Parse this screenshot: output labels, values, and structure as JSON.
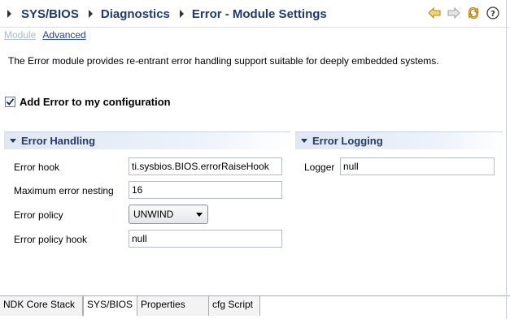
{
  "breadcrumb": {
    "items": [
      "SYS/BIOS",
      "Diagnostics",
      "Error - Module Settings"
    ]
  },
  "header_tools": [
    "back-icon",
    "forward-icon",
    "refresh-icon",
    "help-icon"
  ],
  "subtabs": {
    "module": "Module",
    "advanced": "Advanced"
  },
  "description": "The Error module provides re-entrant error handling support suitable for deeply embedded systems.",
  "add_config": {
    "label": "Add Error to my configuration",
    "checked": true
  },
  "error_handling": {
    "title": "Error Handling",
    "hook_label": "Error hook",
    "hook_value": "ti.sysbios.BIOS.errorRaiseHook",
    "nesting_label": "Maximum error nesting",
    "nesting_value": "16",
    "policy_label": "Error policy",
    "policy_value": "UNWIND",
    "policy_hook_label": "Error policy hook",
    "policy_hook_value": "null"
  },
  "error_logging": {
    "title": "Error Logging",
    "logger_label": "Logger",
    "logger_value": "null"
  },
  "bottom_tabs": [
    "NDK Core Stack",
    "SYS/BIOS",
    "Properties",
    "cfg Script"
  ],
  "active_bottom_tab": "SYS/BIOS",
  "colors": {
    "heading": "#1e3a6e",
    "link": "#1a3fa8",
    "link_disabled": "#a9b8d3"
  }
}
